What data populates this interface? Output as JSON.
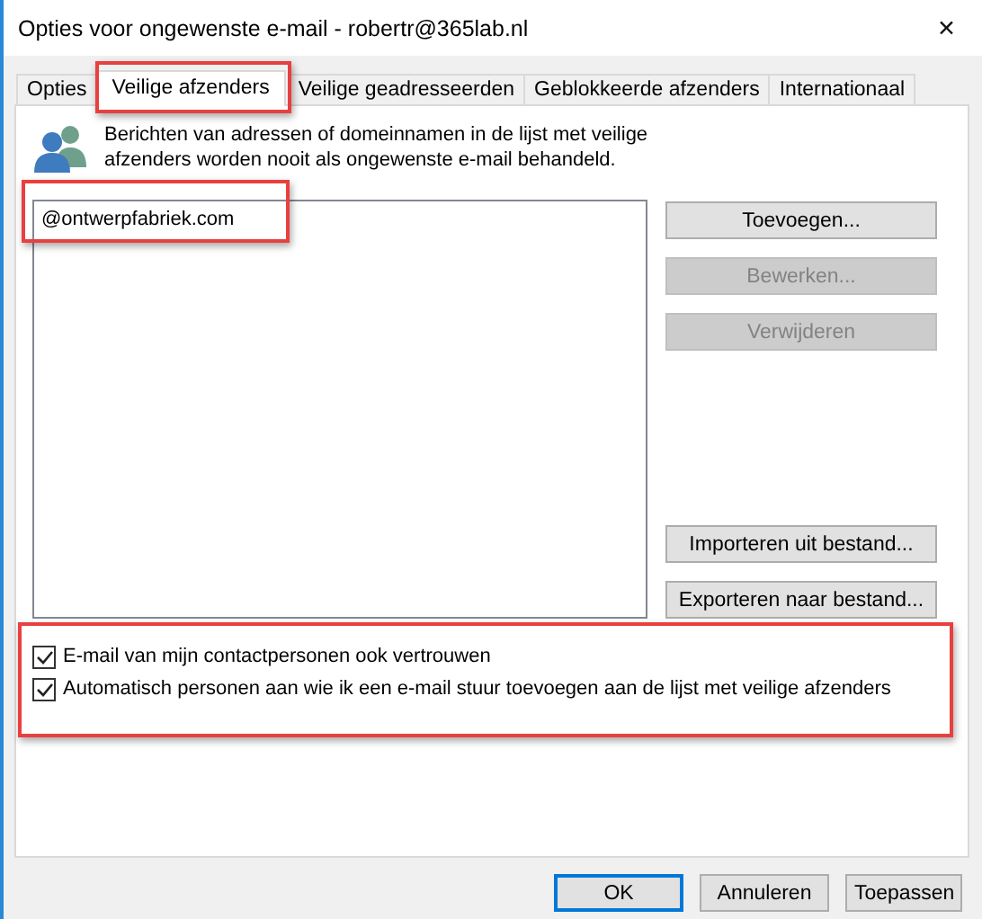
{
  "window": {
    "title": "Opties voor ongewenste e-mail - robertr@365lab.nl",
    "close": "✕"
  },
  "tabs": [
    {
      "label": "Opties",
      "selected": false,
      "highlighted": false
    },
    {
      "label": "Veilige afzenders",
      "selected": true,
      "highlighted": true
    },
    {
      "label": "Veilige geadresseerden",
      "selected": false,
      "highlighted": false
    },
    {
      "label": "Geblokkeerde afzenders",
      "selected": false,
      "highlighted": false
    },
    {
      "label": "Internationaal",
      "selected": false,
      "highlighted": false
    }
  ],
  "description": "Berichten van adressen of domeinnamen in de lijst met veilige afzenders worden nooit als ongewenste e-mail behandeld.",
  "list": {
    "items": [
      {
        "label": "@ontwerpfabriek.com",
        "highlighted": true
      }
    ]
  },
  "side_buttons": [
    {
      "label": "Toevoegen...",
      "disabled": false
    },
    {
      "label": "Bewerken...",
      "disabled": true
    },
    {
      "label": "Verwijderen",
      "disabled": true
    }
  ],
  "file_buttons": [
    {
      "label": "Importeren uit bestand...",
      "disabled": false
    },
    {
      "label": "Exporteren naar bestand...",
      "disabled": false
    }
  ],
  "options": {
    "highlighted": true,
    "items": [
      {
        "label": "E-mail van mijn contactpersonen ook vertrouwen",
        "checked": true
      },
      {
        "label": "Automatisch personen aan wie ik een e-mail stuur toevoegen aan de lijst met veilige afzenders",
        "checked": true
      }
    ]
  },
  "footer_buttons": [
    {
      "label": "OK",
      "default": true
    },
    {
      "label": "Annuleren",
      "default": false
    },
    {
      "label": "Toepassen",
      "default": false
    }
  ]
}
